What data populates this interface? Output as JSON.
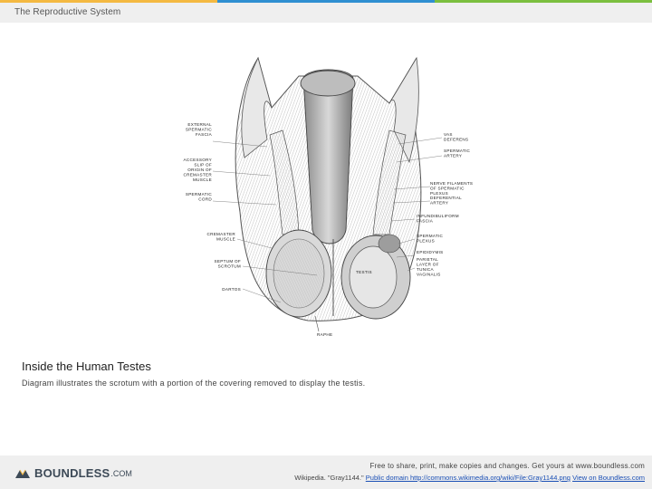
{
  "header": {
    "title": "The Reproductive System",
    "accent_colors": [
      "#f4b942",
      "#2f8fd1",
      "#7bbf3f"
    ]
  },
  "figure": {
    "labels_left": [
      [
        "EXTERNAL",
        "SPERMATIC",
        "FASCIA"
      ],
      [
        "ACCESSORY",
        "SLIP OF",
        "ORIGIN OF",
        "CREMASTER",
        "MUSCLE"
      ],
      [
        "SPERMATIC",
        "CORD"
      ],
      [
        "CREMASTER",
        "MUSCLE"
      ],
      [
        "SEPTUM OF",
        "SCROTUM"
      ],
      [
        "DARTOS"
      ]
    ],
    "labels_right": [
      [
        "VAS",
        "DEFERENS"
      ],
      [
        "SPERMATIC",
        "ARTERY"
      ],
      [
        "NERVE FILAMENTS",
        "OF SPERMATIC",
        "PLEXUS"
      ],
      [
        "DEFERENTIAL",
        "ARTERY"
      ],
      [
        "INFUNDIBULIFORM",
        "FASCIA"
      ],
      [
        "SPERMATIC",
        "PLEXUS"
      ],
      [
        "EPIDIDYMIS"
      ],
      [
        "PARIETAL",
        "LAYER OF",
        "TUNICA",
        "VAGINALIS"
      ]
    ],
    "label_testis": "TESTIS",
    "label_raphe": "RAPHE"
  },
  "caption": {
    "title": "Inside the Human Testes",
    "description": "Diagram illustrates the scrotum with a portion of the covering removed to display the testis."
  },
  "footer": {
    "logo_text": "BOUNDLESS",
    "logo_suffix": ".COM",
    "share_text": "Free to share, print, make copies and changes. Get yours at www.boundless.com",
    "attribution_prefix": "Wikipedia. \"Gray1144.\"",
    "attribution_link": "Public domain http://commons.wikimedia.org/wiki/File:Gray1144.png",
    "view_link": "View on Boundless.com"
  }
}
